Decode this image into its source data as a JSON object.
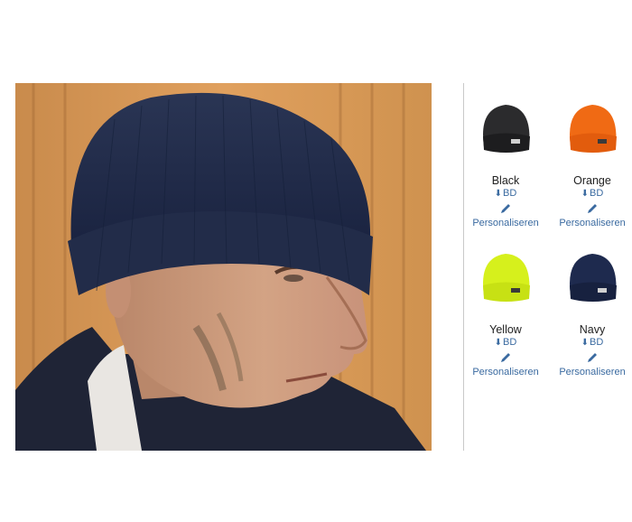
{
  "product_image": {
    "alt": "Man wearing navy knitted beanie"
  },
  "swatches": [
    {
      "name": "Black",
      "download_label": "BD",
      "personalize_label": "Personaliseren",
      "color": "#2b2b2d"
    },
    {
      "name": "Orange",
      "download_label": "BD",
      "personalize_label": "Personaliseren",
      "color": "#f06a14"
    },
    {
      "name": "Yellow",
      "download_label": "BD",
      "personalize_label": "Personaliseren",
      "color": "#d6f01c"
    },
    {
      "name": "Navy",
      "download_label": "BD",
      "personalize_label": "Personaliseren",
      "color": "#1e2a4e"
    }
  ],
  "colors": {
    "link": "#3a6aa0",
    "divider": "#c9c9c9"
  }
}
